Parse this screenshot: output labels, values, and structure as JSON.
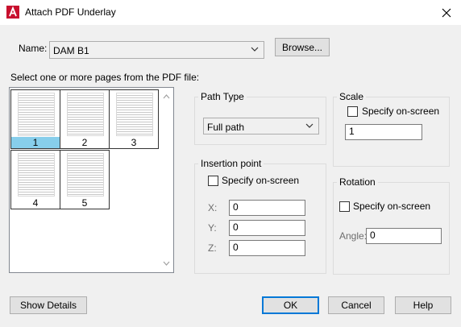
{
  "window": {
    "title": "Attach PDF Underlay",
    "app_icon": "autocad-icon",
    "close_icon": "close-icon"
  },
  "name_row": {
    "label": "Name:",
    "value": "DAM B1",
    "browse_label": "Browse..."
  },
  "pages": {
    "label": "Select one or more pages from the PDF file:",
    "items": [
      {
        "number": "1",
        "selected": true
      },
      {
        "number": "2",
        "selected": false
      },
      {
        "number": "3",
        "selected": false
      },
      {
        "number": "4",
        "selected": false
      },
      {
        "number": "5",
        "selected": false
      }
    ]
  },
  "path_type": {
    "title": "Path Type",
    "value": "Full path"
  },
  "insertion_point": {
    "title": "Insertion point",
    "specify_label": "Specify on-screen",
    "x_label": "X:",
    "x_value": "0",
    "y_label": "Y:",
    "y_value": "0",
    "z_label": "Z:",
    "z_value": "0"
  },
  "scale": {
    "title": "Scale",
    "specify_label": "Specify on-screen",
    "value": "1"
  },
  "rotation": {
    "title": "Rotation",
    "specify_label": "Specify on-screen",
    "angle_label": "Angle:",
    "angle_value": "0"
  },
  "buttons": {
    "show_details": "Show Details",
    "ok": "OK",
    "cancel": "Cancel",
    "help": "Help"
  },
  "colors": {
    "accent": "#0078d7",
    "selection": "#87ceeb",
    "app_icon_red": "#c8102e"
  }
}
